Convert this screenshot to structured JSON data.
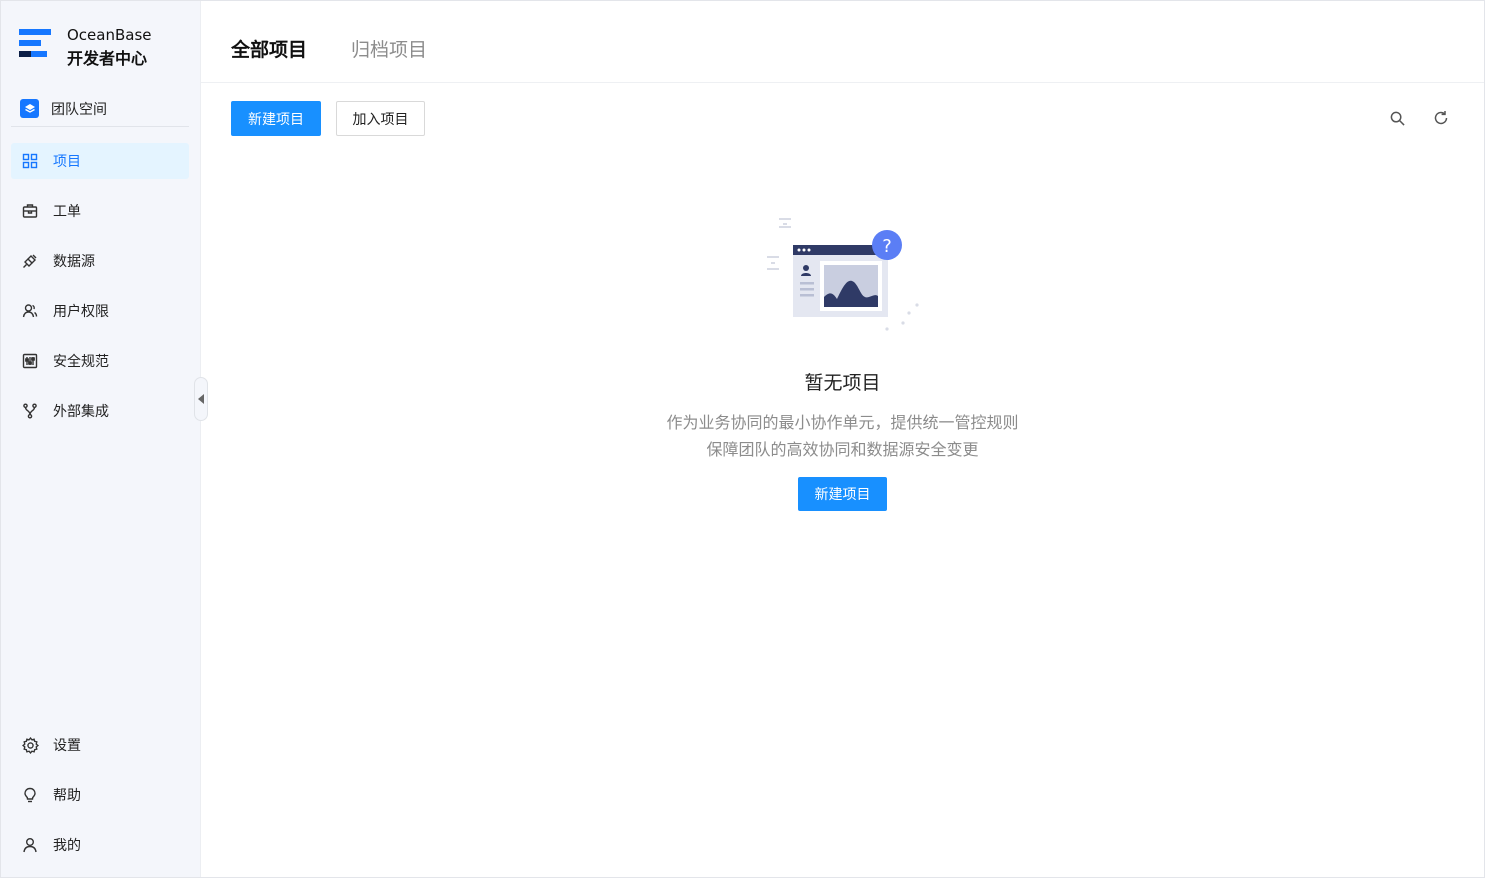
{
  "brand": {
    "name": "OceanBase",
    "subtitle": "开发者中心"
  },
  "team": {
    "label": "团队空间",
    "icon": "layers-icon"
  },
  "nav": [
    {
      "label": "项目",
      "icon": "grid-icon",
      "active": true
    },
    {
      "label": "工单",
      "icon": "ticket-icon"
    },
    {
      "label": "数据源",
      "icon": "plug-icon"
    },
    {
      "label": "用户权限",
      "icon": "users-icon"
    },
    {
      "label": "安全规范",
      "icon": "sliders-icon"
    },
    {
      "label": "外部集成",
      "icon": "fork-icon"
    }
  ],
  "bottom_nav": [
    {
      "label": "设置",
      "icon": "gear-icon"
    },
    {
      "label": "帮助",
      "icon": "bulb-icon"
    },
    {
      "label": "我的",
      "icon": "user-icon"
    }
  ],
  "tabs": {
    "all": "全部项目",
    "archived": "归档项目"
  },
  "toolbar": {
    "new_project": "新建项目",
    "join_project": "加入项目"
  },
  "empty": {
    "title": "暂无项目",
    "desc_line1": "作为业务协同的最小协作单元，提供统一管控规则",
    "desc_line2": "保障团队的高效协同和数据源安全变更",
    "button": "新建项目"
  },
  "colors": {
    "primary": "#1890ff",
    "sidebar_bg": "#f4f6fb",
    "active_bg": "#e4f4ff"
  }
}
